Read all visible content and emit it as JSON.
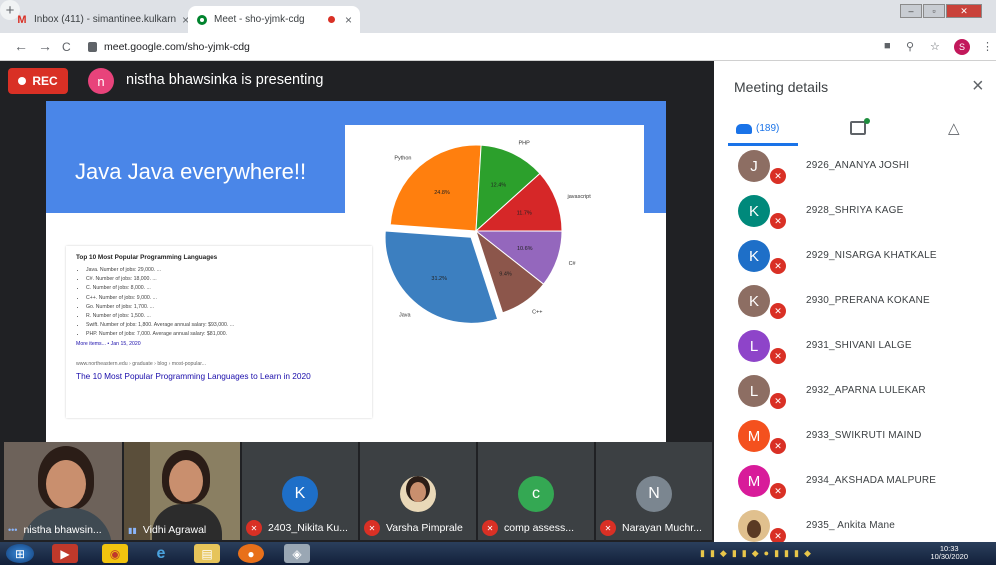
{
  "browser": {
    "tabs": [
      {
        "title": "Inbox (411) - simantinee.kulkarn",
        "icon": "gmail-icon",
        "close": "×"
      },
      {
        "title": "Meet - sho-yjmk-cdg",
        "icon": "meet-icon",
        "close": "×"
      }
    ],
    "new_tab": "+",
    "url": "meet.google.com/sho-yjmk-cdg",
    "nav": {
      "back": "←",
      "forward": "→",
      "reload": "C"
    },
    "profile_initial": "S"
  },
  "meeting": {
    "rec_label": "REC",
    "presenter_initial": "n",
    "presenting_text": "nistha bhawsinka is presenting"
  },
  "slide": {
    "title": "Java Java everywhere!!",
    "snippet": {
      "heading": "Top 10 Most Popular Programming Languages",
      "items": [
        "Java. Number of jobs: 29,000. ...",
        "C#. Number of jobs: 18,000. ...",
        "C. Number of jobs: 8,000. ...",
        "C++. Number of jobs: 9,000. ...",
        "Go. Number of jobs: 1,700. ...",
        "R. Number of jobs: 1,500. ...",
        "Swift. Number of jobs: 1,800. Average annual salary: $93,000. ...",
        "PHP. Number of jobs: 7,000. Average annual salary: $81,000."
      ],
      "more": "More items... • Jan 15, 2020",
      "source": "www.northeastern.edu › graduate › blog › most-popular...",
      "link": "The 10 Most Popular Programming Languages to Learn in 2020"
    }
  },
  "chart_data": {
    "type": "pie",
    "title": "",
    "slices": [
      {
        "label": "Java",
        "value": 31.2,
        "color": "#3c7fc0"
      },
      {
        "label": "Python",
        "value": 24.8,
        "color": "#ff7f0e"
      },
      {
        "label": "PHP",
        "value": 12.4,
        "color": "#2ca02c"
      },
      {
        "label": "javascript",
        "value": 11.7,
        "color": "#d62728"
      },
      {
        "label": "C#",
        "value": 10.6,
        "color": "#9467bd"
      },
      {
        "label": "C++",
        "value": 9.4,
        "color": "#8c564b"
      }
    ],
    "value_format": "{v}%",
    "exploded": "Java"
  },
  "filmstrip": [
    {
      "name": "nistha bhawsin...",
      "type": "camera",
      "muted": false,
      "indicator": "•••"
    },
    {
      "name": "Vidhi Agrawal",
      "type": "camera",
      "muted": false,
      "indicator": "▮▮"
    },
    {
      "name": "2403_Nikita Ku...",
      "type": "avatar",
      "initial": "K",
      "color": "#1e6fc8",
      "muted": true
    },
    {
      "name": "Varsha Pimprale",
      "type": "photo",
      "muted": true
    },
    {
      "name": "comp assess...",
      "type": "avatar",
      "initial": "c",
      "color": "#34a853",
      "muted": true
    },
    {
      "name": "Narayan Muchr...",
      "type": "avatar",
      "initial": "N",
      "color": "#7b8690",
      "muted": true
    }
  ],
  "panel": {
    "title": "Meeting details",
    "close": "×",
    "people_count": "(189)",
    "participants": [
      {
        "initial": "J",
        "name": "2926_ANANYA JOSHI",
        "color": "#8d6e63"
      },
      {
        "initial": "K",
        "name": "2928_SHRIYA KAGE",
        "color": "#00897b"
      },
      {
        "initial": "K",
        "name": "2929_NISARGA KHATKALE",
        "color": "#1e6fc8"
      },
      {
        "initial": "K",
        "name": "2930_PRERANA KOKANE",
        "color": "#8d6e63"
      },
      {
        "initial": "L",
        "name": "2931_SHIVANI LALGE",
        "color": "#8e44c9"
      },
      {
        "initial": "L",
        "name": "2932_APARNA LULEKAR",
        "color": "#8d6e63"
      },
      {
        "initial": "M",
        "name": "2933_SWIKRUTI MAIND",
        "color": "#f4511e"
      },
      {
        "initial": "M",
        "name": "2934_AKSHADA MALPURE",
        "color": "#d81b9a"
      },
      {
        "initial": "",
        "name": "2935_ Ankita Mane",
        "color": "#e0c08e"
      }
    ]
  },
  "taskbar": {
    "time": "10:33",
    "date": "10/30/2020"
  }
}
